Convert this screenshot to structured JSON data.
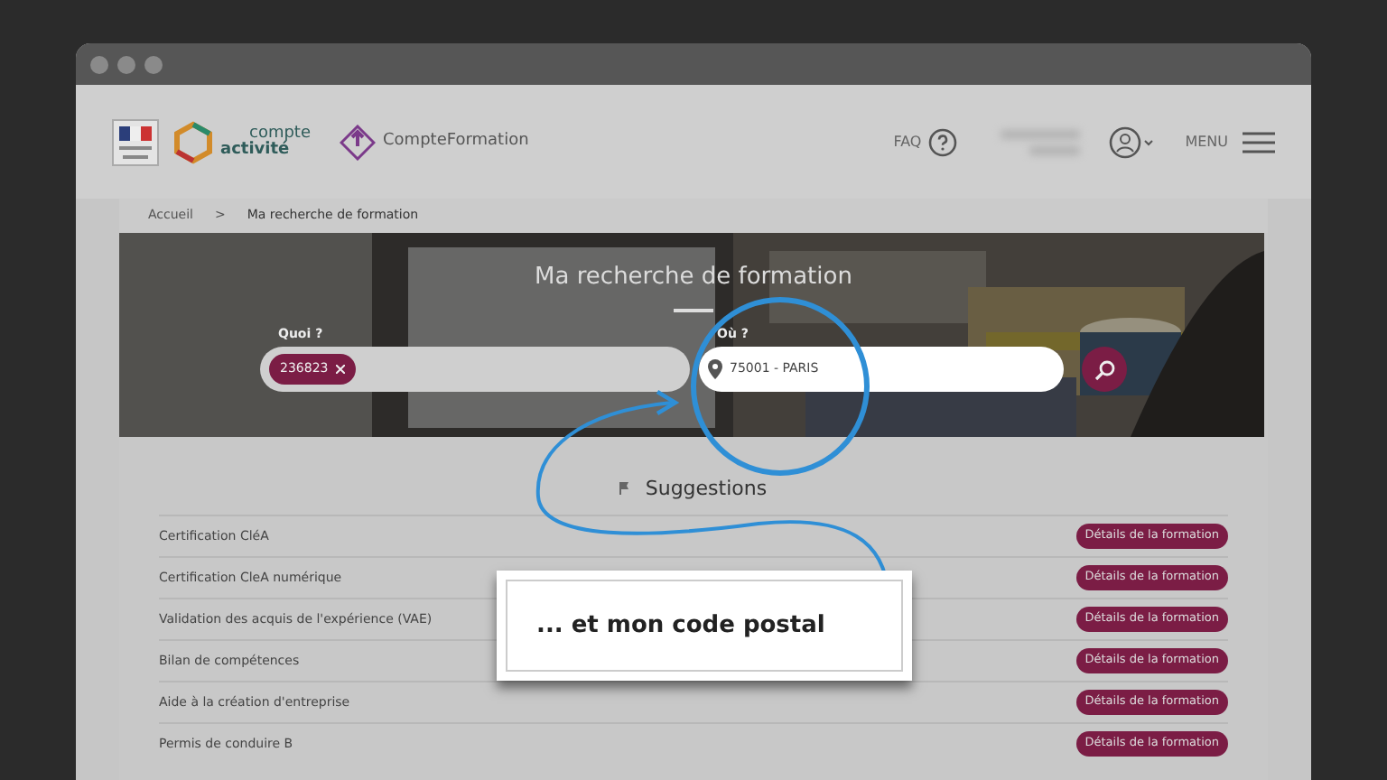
{
  "header": {
    "logo_texts": [
      "compte",
      "activité",
      "CompteFormation"
    ],
    "faq": "FAQ",
    "menu": "MENU"
  },
  "breadcrumb": [
    {
      "label": "Accueil",
      "kind": "link"
    },
    {
      "label": ">",
      "kind": "separator"
    },
    {
      "label": "Ma recherche de formation",
      "kind": "current"
    }
  ],
  "hero": {
    "kind": "picture",
    "title": "Ma recherche de formation",
    "what": {
      "label": "Quoi ?",
      "tags": [
        "236823"
      ]
    },
    "where": {
      "label": "Où ?",
      "value": "75001 - PARIS"
    }
  },
  "suggestions": {
    "title": "Suggestions",
    "rows": [
      {
        "name": "Certification CléA",
        "action": "Détails de la formation"
      },
      {
        "name": "Certification CleA numérique",
        "action": "Détails de la formation"
      },
      {
        "name": "Validation des acquis de l'expérience (VAE)",
        "action": "Détails de la formation"
      },
      {
        "name": "Bilan de compétences",
        "action": "Détails de la formation"
      },
      {
        "name": "Aide à la création d'entreprise",
        "action": "Détails de la formation"
      },
      {
        "name": "Permis de conduire B",
        "action": "Détails de la formation"
      }
    ]
  },
  "callout": {
    "text": "... et mon code postal"
  }
}
